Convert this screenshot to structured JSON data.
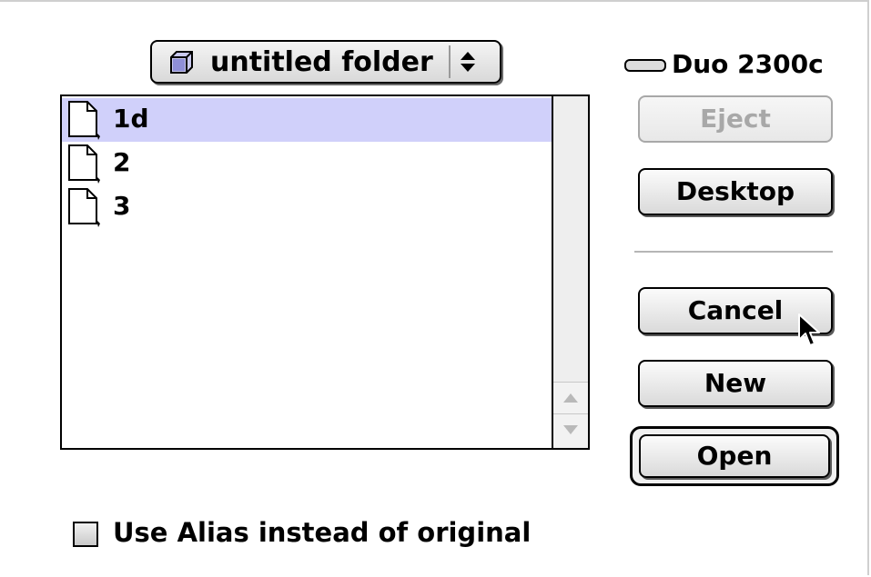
{
  "dialog": {
    "folder_popup": {
      "selected": "untitled folder",
      "icon": "folder-icon"
    },
    "volume": {
      "name": "Duo 2300c",
      "icon": "hard-disk-icon"
    },
    "file_list": {
      "items": [
        {
          "label": "1d",
          "icon": "document-icon",
          "selected": true
        },
        {
          "label": "2",
          "icon": "document-icon",
          "selected": false
        },
        {
          "label": "3",
          "icon": "document-icon",
          "selected": false
        }
      ]
    },
    "buttons": {
      "eject": "Eject",
      "desktop": "Desktop",
      "cancel": "Cancel",
      "new": "New",
      "open": "Open"
    },
    "alias_option": {
      "label": "Use Alias instead of original",
      "checked": false
    }
  },
  "colors": {
    "selection": "#d0d0fa",
    "disabled_text": "#a8a8a8",
    "scrollbar_track": "#eeeeee"
  }
}
